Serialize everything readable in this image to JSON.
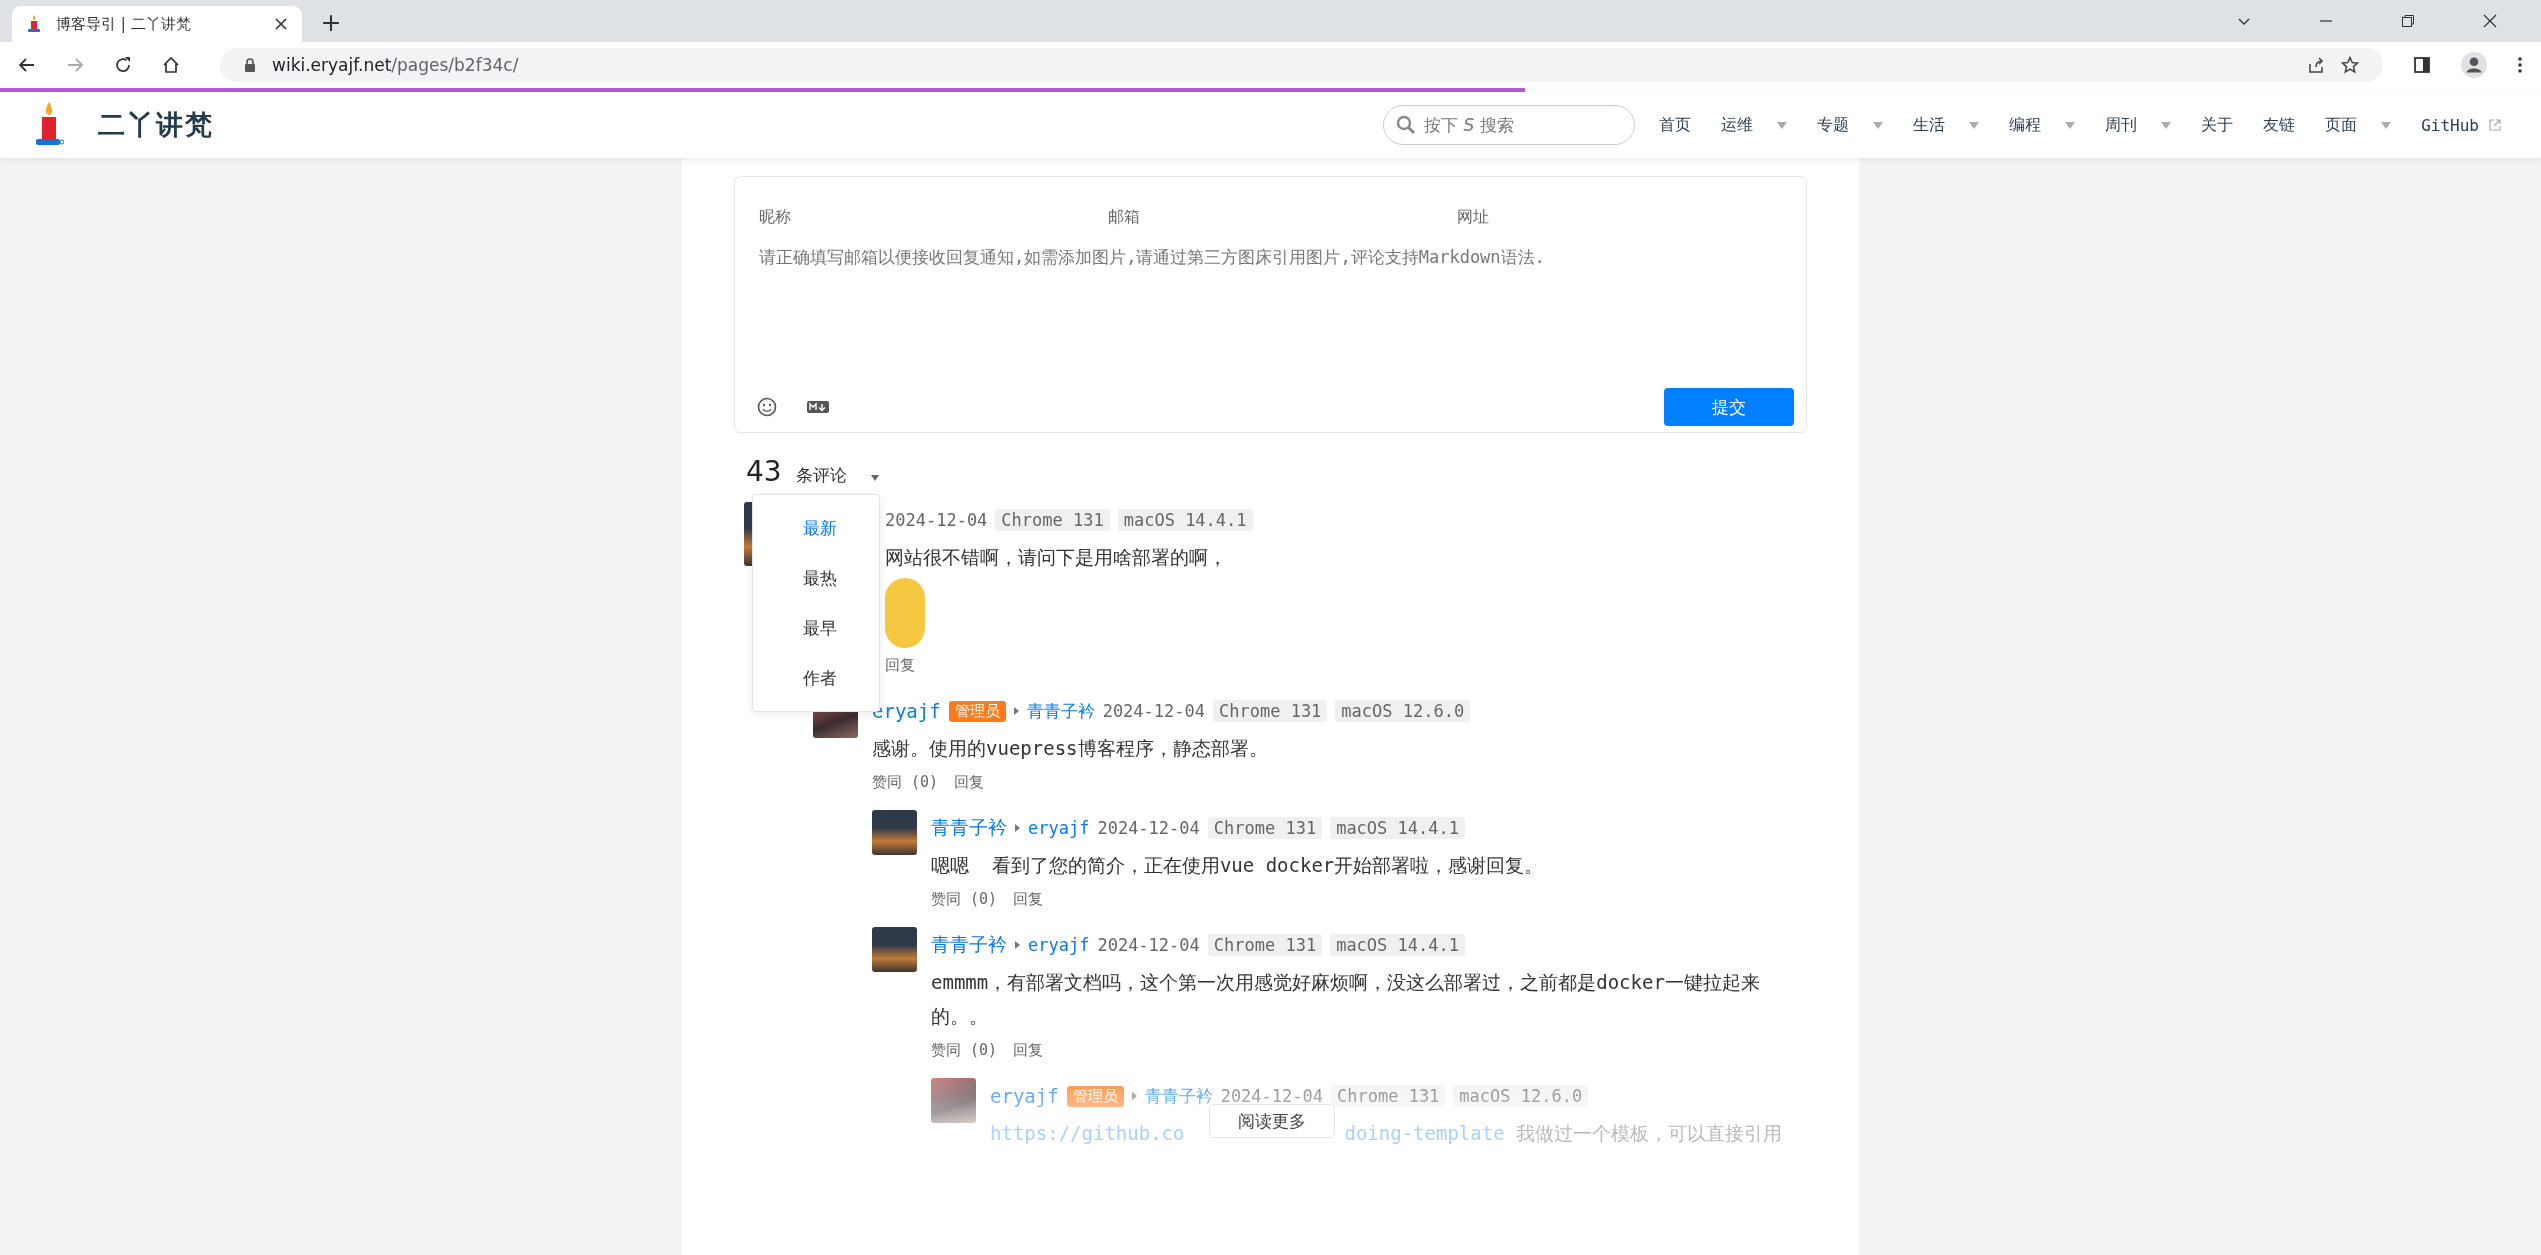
{
  "browser": {
    "tab_title": "博客导引 | 二丫讲梵",
    "url_host": "wiki.eryajf.net",
    "url_path": "/pages/b2f34c/",
    "load_progress": {
      "level": 0.6
    }
  },
  "site": {
    "title": "二丫讲梵",
    "search_placeholder": "按下 *S* 搜索",
    "nav": [
      {
        "label": "首页",
        "dropdown": false
      },
      {
        "label": "运维",
        "dropdown": true
      },
      {
        "label": "专题",
        "dropdown": true
      },
      {
        "label": "生活",
        "dropdown": true
      },
      {
        "label": "编程",
        "dropdown": true
      },
      {
        "label": "周刊",
        "dropdown": true
      },
      {
        "label": "关于",
        "dropdown": false
      },
      {
        "label": "友链",
        "dropdown": false
      },
      {
        "label": "页面",
        "dropdown": true
      },
      {
        "label": "GitHub",
        "dropdown": false,
        "external": true
      }
    ]
  },
  "form": {
    "field_placeholders": [
      "昵称",
      "邮箱",
      "网址"
    ],
    "textarea_placeholder": "请正确填写邮箱以便接收回复通知,如需添加图片,请通过第三方图床引用图片,评论支持Markdown语法.",
    "submit": "提交"
  },
  "count": "43",
  "count_label": "条评论",
  "sort_menu": [
    {
      "label": "最新",
      "selected": true
    },
    {
      "label": "最热",
      "selected": false
    },
    {
      "label": "最早",
      "selected": false
    },
    {
      "label": "作者",
      "selected": false
    }
  ],
  "comments": [
    {
      "date": "2024-12-04",
      "browser": "Chrome 131",
      "os": "macOS 14.4.1",
      "content": [
        {
          "kind": "text",
          "text": "网站很不错啊，请问下是用啥部署的啊，"
        }
      ],
      "emoji": true,
      "reply": "回复",
      "children": [
        {
          "nick": "eryajf",
          "badge": "管理员",
          "reply_to": "青青子衿",
          "date": "2024-12-04",
          "browser": "Chrome 131",
          "os": "macOS 12.6.0",
          "content": [
            {
              "kind": "text",
              "text": "感谢。使用的vuepress博客程序，静态部署。"
            }
          ],
          "likes": "赞同 (0)",
          "reply": "回复",
          "children": [
            {
              "nick": "青青子衿",
              "reply_to": "eryajf",
              "date": "2024-12-04",
              "browser": "Chrome 131",
              "os": "macOS 14.4.1",
              "content": [
                {
                  "kind": "text",
                  "text": "嗯嗯  看到了您的简介，正在使用vue docker开始部署啦，感谢回复。"
                }
              ],
              "likes": "赞同 (0)",
              "reply": "回复"
            },
            {
              "nick": "青青子衿",
              "reply_to": "eryajf",
              "date": "2024-12-04",
              "browser": "Chrome 131",
              "os": "macOS 14.4.1",
              "content": [
                {
                  "kind": "text",
                  "text": "emmmm，有部署文档吗，这个第一次用感觉好麻烦啊，没这么部署过，之前都是docker一键拉起来的。。"
                }
              ],
              "likes": "赞同 (0)",
              "reply": "回复",
              "children": [
                {
                  "nick": "eryajf",
                  "badge": "管理员",
                  "reply_to": "青青子衿",
                  "date": "2024-12-04",
                  "browser": "Chrome 131",
                  "os": "macOS 12.6.0",
                  "content": [
                    {
                      "kind": "link",
                      "text": "https://github.co"
                    },
                    {
                      "kind": "gap"
                    },
                    {
                      "kind": "link",
                      "text": "doing-template"
                    },
                    {
                      "kind": "text",
                      "text": " 我做过一个模板，可以直接引用"
                    }
                  ]
                }
              ]
            }
          ]
        }
      ]
    }
  ],
  "read_more": "阅读更多"
}
